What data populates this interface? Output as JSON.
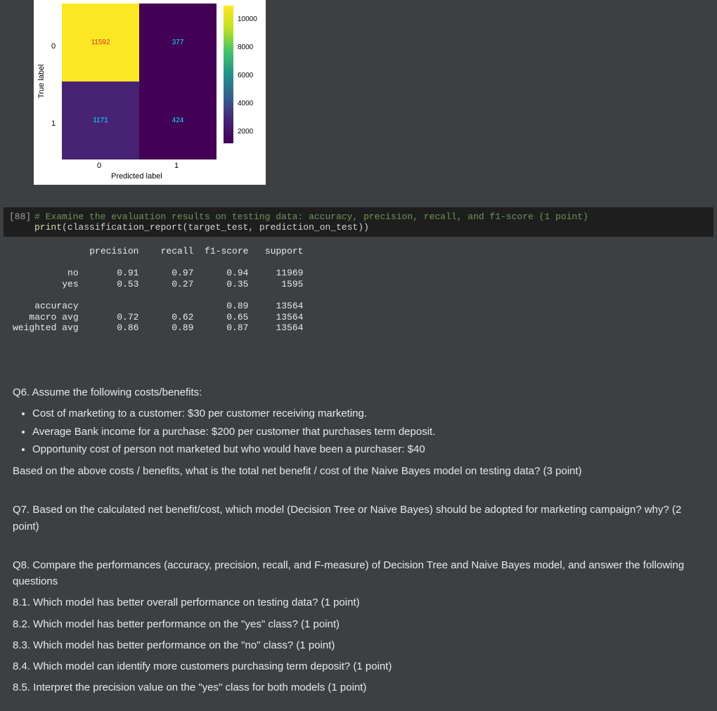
{
  "chart_data": {
    "type": "heatmap",
    "title": "",
    "xlabel": "Predicted label",
    "ylabel": "True label",
    "x_categories": [
      "0",
      "1"
    ],
    "y_categories": [
      "0",
      "1"
    ],
    "values": [
      [
        11592,
        377
      ],
      [
        1171,
        424
      ]
    ],
    "colorbar_ticks": [
      "10000",
      "8000",
      "6000",
      "4000",
      "2000"
    ]
  },
  "code_cell": {
    "prompt": "[88]",
    "comment": "# Examine the evaluation results on testing data: accuracy, precision, recall, and f1-score (1 point)",
    "line2_fn": "print",
    "line2_open": "(",
    "line2_call": "classification_report",
    "line2_args": "(target_test, prediction_on_test))"
  },
  "report": {
    "header": "              precision    recall  f1-score   support",
    "row_no": "          no       0.91      0.97      0.94     11969",
    "row_yes": "         yes       0.53      0.27      0.35      1595",
    "row_acc": "    accuracy                           0.89     13564",
    "row_macro": "   macro avg       0.72      0.62      0.65     13564",
    "row_wavg": "weighted avg       0.86      0.89      0.87     13564"
  },
  "markdown": {
    "q6_title": "Q6. Assume the following costs/benefits:",
    "q6_b1": "Cost of marketing to a customer: $30 per customer receiving marketing.",
    "q6_b2": "Average Bank income for a purchase: $200 per customer that purchases term deposit.",
    "q6_b3": "Opportunity cost of person not marketed but who would have been a purchaser: $40",
    "q6_p": "Based on the above costs / benefits, what is the total net benefit / cost of the Naive Bayes model on testing data? (3 point)",
    "q7": "Q7. Based on the calculated net benefit/cost, which model (Decision Tree or Naive Bayes) should be adopted for marketing campaign? why? (2 point)",
    "q8_title": "Q8. Compare the performances (accuracy, precision, recall, and F-measure) of Decision Tree and Naive Bayes model, and answer the following questions",
    "q8_1": "8.1. Which model has better overall performance on testing data? (1 point)",
    "q8_2": "8.2. Which model has better performance on the \"yes\" class? (1 point)",
    "q8_3": "8.3. Which model has better performance on the \"no\" class? (1 point)",
    "q8_4": "8.4. Which model can identify more customers purchasing term deposit? (1 point)",
    "q8_5": "8.5. Interpret the precision value on the \"yes\" class for both models (1 point)"
  }
}
